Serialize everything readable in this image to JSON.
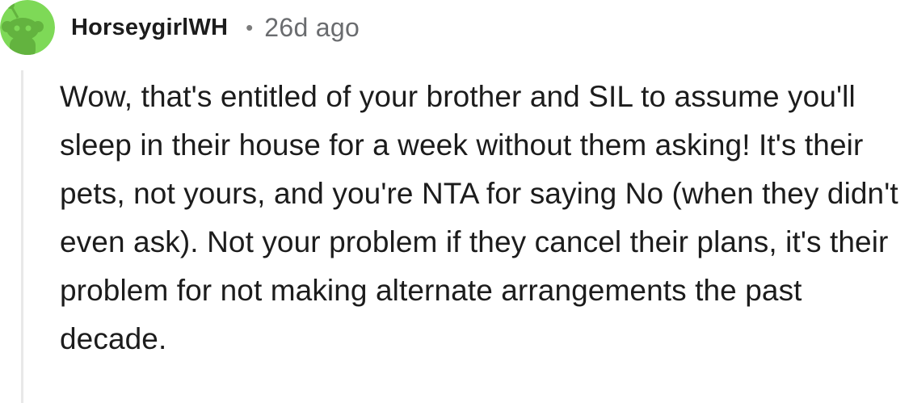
{
  "comment": {
    "avatar": {
      "icon": "reddit-snoo-avatar-icon",
      "background_color": "#7ed957",
      "figure_color": "#63b33f"
    },
    "author": "HorseygirlWH",
    "separator": "•",
    "timestamp": "26d ago",
    "body": "Wow, that's entitled of your brother and SIL to assume you'll sleep in their house for a week without them asking! It's their pets, not yours, and you're NTA for saying No (when they didn't even ask). Not your problem if they cancel their plans, it's their problem for not making alternate arrangements the past decade."
  }
}
